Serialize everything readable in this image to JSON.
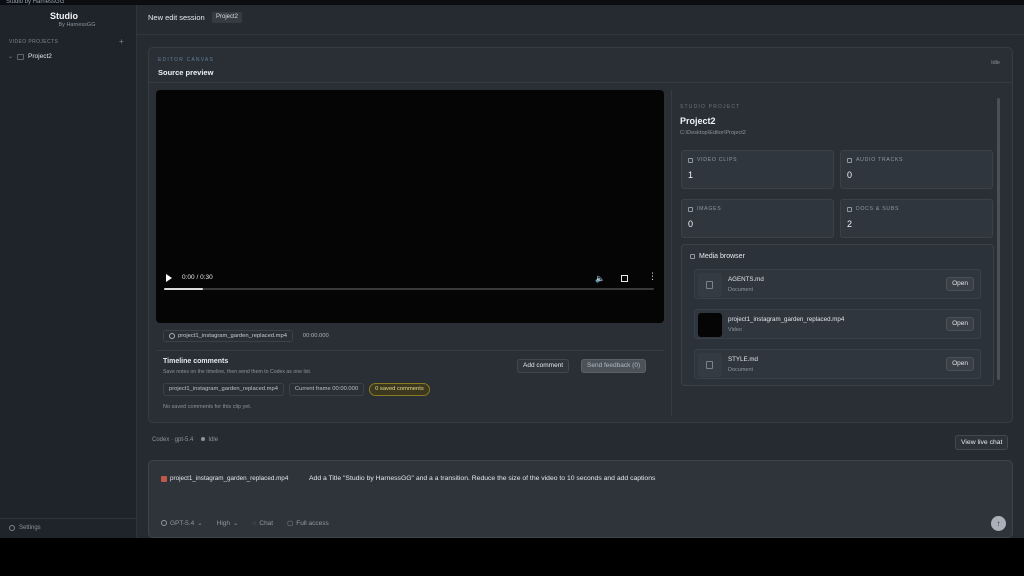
{
  "window": {
    "title": "Studio by HarnessGG"
  },
  "sidebar": {
    "brand_title": "Studio",
    "brand_sub": "By HarnessGG",
    "section_label": "VIDEO PROJECTS",
    "add_symbol": "+",
    "projects": [
      {
        "label": "Project2"
      }
    ],
    "settings_label": "Settings"
  },
  "header": {
    "session_title": "New edit session",
    "project_chip": "Project2"
  },
  "editor": {
    "eyebrow": "EDITOR CANVAS",
    "title": "Source preview",
    "status": "Idle",
    "player": {
      "time": "0:00 / 0:30",
      "progress": 0.08
    },
    "clip_name": "project1_instagram_garden_replaced.mp4",
    "clip_timecode": "00:00.000",
    "timeline_comments": {
      "title": "Timeline comments",
      "subtitle": "Save notes on the timeline, then send them to Codex as one list.",
      "add_label": "Add comment",
      "send_label": "Send feedback (0)",
      "clip_chip": "project1_instagram_garden_replaced.mp4",
      "frame_chip": "Current frame 00:00.000",
      "saved_chip": "0 saved comments",
      "empty_text": "No saved comments for this clip yet."
    }
  },
  "project": {
    "eyebrow": "STUDIO PROJECT",
    "name": "Project2",
    "path": "C:\\Desktop\\Editor\\Project2",
    "stats": {
      "video_label": "VIDEO CLIPS",
      "video_value": "1",
      "audio_label": "AUDIO TRACKS",
      "audio_value": "0",
      "images_label": "IMAGES",
      "images_value": "0",
      "docs_label": "DOCS & SUBS",
      "docs_value": "2"
    },
    "media_browser": {
      "title": "Media browser",
      "items": [
        {
          "name": "AGENTS.md",
          "type": "Document",
          "open": "Open"
        },
        {
          "name": "project1_instagram_garden_replaced.mp4",
          "type": "Video",
          "open": "Open"
        },
        {
          "name": "STYLE.md",
          "type": "Document",
          "open": "Open"
        }
      ]
    }
  },
  "codex": {
    "model_label": "Codex · gpt-5.4",
    "status": "Idle",
    "view_live": "View live chat"
  },
  "composer": {
    "attachment": "project1_instagram_garden_replaced.mp4",
    "prompt": "Add a Title \"Studio by HarnessGG\" and a a transition. Reduce the size of the video to 10 seconds and add captions",
    "model": "GPT-5.4",
    "reasoning": "High",
    "mode": "Chat",
    "access": "Full access",
    "send_symbol": "↑"
  },
  "colors": {
    "accent_saved": "#e6d98b",
    "eyebrow": "#5f7f98",
    "attachment_icon": "#c0584a"
  }
}
